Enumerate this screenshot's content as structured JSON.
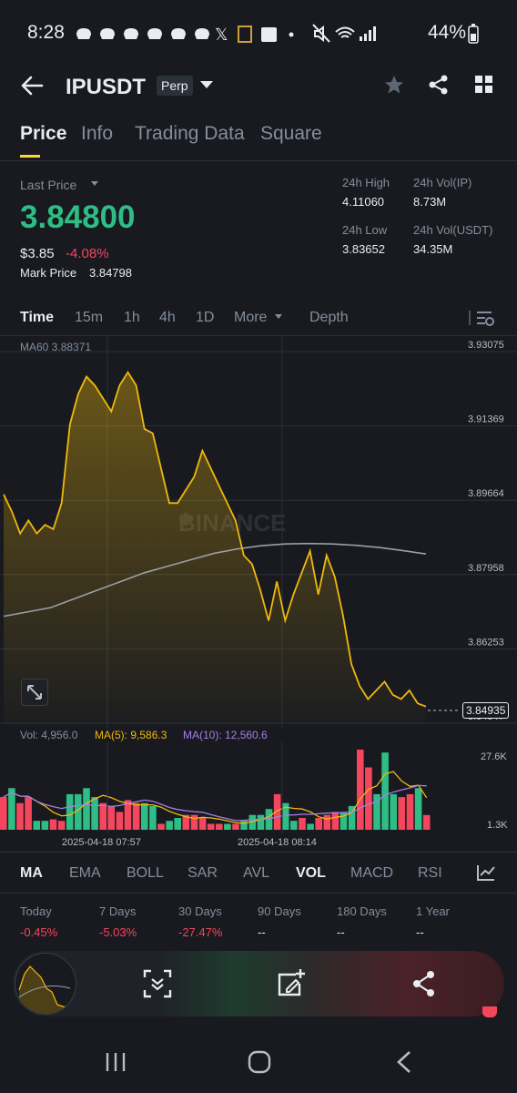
{
  "status_bar": {
    "time": "8:28",
    "battery": "44%"
  },
  "header": {
    "pair": "IPUSDT",
    "badge": "Perp",
    "icons": [
      "back-arrow-icon",
      "chevron-down-icon",
      "star-icon",
      "share-icon",
      "grid-icon"
    ]
  },
  "tabs": [
    "Price",
    "Info",
    "Trading Data",
    "Square"
  ],
  "price": {
    "last_price_label": "Last Price",
    "last_price": "3.84800",
    "usd_price": "$3.85",
    "change_pct": "-4.08%",
    "mark_label": "Mark Price",
    "mark_value": "3.84798"
  },
  "stats": {
    "high_label": "24h High",
    "high_value": "4.11060",
    "low_label": "24h Low",
    "low_value": "3.83652",
    "vol_ip_label": "24h Vol(IP)",
    "vol_ip_value": "8.73M",
    "vol_usdt_label": "24h Vol(USDT)",
    "vol_usdt_value": "34.35M"
  },
  "time_tabs": [
    "Time",
    "15m",
    "1h",
    "4h",
    "1D",
    "More",
    "Depth"
  ],
  "chart": {
    "ma60": "MA60 3.88371",
    "watermark": "BINANCE",
    "y_labels": [
      "3.93075",
      "3.91369",
      "3.89664",
      "3.87958",
      "3.86253",
      "3.84547"
    ],
    "current_price": "3.84935",
    "accent_line": "#f0b90b",
    "ma_line": "#9aa0a8"
  },
  "chart_data": {
    "type": "line",
    "x_labels": [
      "2025-04-18 07:57",
      "2025-04-18 08:14"
    ],
    "ylim": [
      3.84547,
      3.93075
    ],
    "price": [
      3.898,
      3.894,
      3.889,
      3.892,
      3.889,
      3.891,
      3.89,
      3.896,
      3.914,
      3.921,
      3.925,
      3.923,
      3.92,
      3.917,
      3.923,
      3.926,
      3.923,
      3.913,
      3.912,
      3.904,
      3.896,
      3.896,
      3.899,
      3.902,
      3.908,
      3.904,
      3.9,
      3.896,
      3.892,
      3.884,
      3.882,
      3.876,
      3.869,
      3.878,
      3.869,
      3.875,
      3.88,
      3.885,
      3.875,
      3.884,
      3.879,
      3.87,
      3.859,
      3.854,
      3.851,
      3.853,
      3.855,
      3.852,
      3.851,
      3.853,
      3.85,
      3.8493
    ],
    "ma60": [
      3.87,
      3.871,
      3.872,
      3.874,
      3.876,
      3.878,
      3.88,
      3.8815,
      3.883,
      3.8845,
      3.8855,
      3.8862,
      3.8866,
      3.8867,
      3.8866,
      3.8863,
      3.8858,
      3.8851,
      3.8843
    ],
    "volume_title": "Vol: 4,956.0",
    "ma5_label": "MA(5): 9,586.3",
    "ma10_label": "MA(10): 12,560.6",
    "volume_ticks": [
      "27.6K",
      "1.3K"
    ],
    "volume": [
      11000,
      14000,
      9000,
      11000,
      3000,
      3000,
      3500,
      3000,
      12000,
      12000,
      14000,
      11000,
      9000,
      8000,
      6000,
      10000,
      9000,
      9000,
      8000,
      2000,
      3000,
      4000,
      5000,
      5000,
      4000,
      2000,
      2000,
      2000,
      2000,
      3000,
      5000,
      5000,
      7000,
      12000,
      9000,
      3000,
      4000,
      2000,
      4000,
      5000,
      6000,
      6000,
      8000,
      27000,
      21000,
      12000,
      26000,
      12000,
      11000,
      12000,
      14000,
      4956
    ],
    "volume_up": [
      false,
      true,
      false,
      false,
      true,
      true,
      false,
      false,
      true,
      true,
      true,
      true,
      false,
      false,
      false,
      false,
      false,
      true,
      true,
      false,
      true,
      true,
      false,
      false,
      false,
      false,
      false,
      true,
      false,
      true,
      true,
      true,
      true,
      false,
      true,
      true,
      false,
      true,
      false,
      false,
      false,
      true,
      true,
      false,
      false,
      true,
      true,
      true,
      false,
      false,
      true,
      false
    ]
  },
  "indicator_tabs": [
    "MA",
    "EMA",
    "BOLL",
    "SAR",
    "AVL",
    "VOL",
    "MACD",
    "RSI"
  ],
  "performance": [
    {
      "label": "Today",
      "value": "-0.45%"
    },
    {
      "label": "7 Days",
      "value": "-5.03%"
    },
    {
      "label": "30 Days",
      "value": "-27.47%"
    },
    {
      "label": "90 Days",
      "value": "--"
    },
    {
      "label": "180 Days",
      "value": "--"
    },
    {
      "label": "1 Year",
      "value": "--"
    }
  ],
  "colors": {
    "up": "#2ebd85",
    "down": "#f6465d",
    "yellow": "#fcd535",
    "ma10": "#a67ee8"
  }
}
